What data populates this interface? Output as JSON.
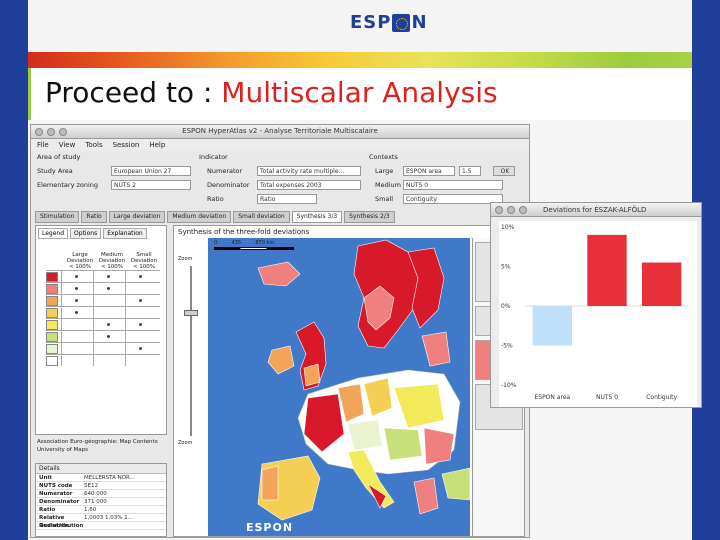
{
  "slide": {
    "logo_text": "ESP",
    "logo_text_end": "N",
    "title_plain": "Proceed to : ",
    "title_highlight": "Multiscalar Analysis"
  },
  "app": {
    "window_title": "ESPON HyperAtlas v2 - Analyse Territoriale Multiscalaire",
    "menu": [
      "File",
      "View",
      "Tools",
      "Session",
      "Help"
    ],
    "area_of_study_label": "Area of study",
    "study_area_label": "Study Area",
    "study_area_value": "European Union 27",
    "elementary_zoning_label": "Elementary zoning",
    "elementary_zoning_value": "NUTS 2",
    "indicator_label": "Indicator",
    "numerator_label": "Numerator",
    "numerator_value": "Total activity rate multiple...",
    "denominator_label": "Denominator",
    "denominator_value": "Total expenses 2003",
    "ratio_label": "Ratio",
    "ratio_value": "Ratio",
    "contexts_label": "Contexts",
    "large_label": "Large",
    "large_value": "ESPON area",
    "large_num": "1.5",
    "large_button": "OK",
    "medium_label": "Medium",
    "medium_value": "NUTS 0",
    "small_label": "Small",
    "small_value": "Contiguity",
    "tabs": [
      "Stimulation",
      "Ratio",
      "Large deviation",
      "Medium deviation",
      "Small deviation",
      "Synthesis 3/3",
      "Synthesis 2/3"
    ],
    "legend_tabs": [
      "Legend",
      "Options",
      "Explanation"
    ],
    "legend_headers": [
      "Large Deviation",
      "Medium Deviation",
      "Small Deviation"
    ],
    "legend_headers_sub": [
      "< 100%",
      "< 100%",
      "< 100%"
    ],
    "map_title": "Synthesis of the three-fold deviations",
    "scale_labels": [
      "0",
      "435",
      "870",
      "km"
    ],
    "zoom_label_top": "Zoom",
    "zoom_label_bottom": "Zoom",
    "map_credit": "Association Euro-géographie: Map Contents",
    "map_credit2": "University of Maps",
    "details_label": "Details",
    "details": [
      {
        "k": "Unit",
        "v": "MELLERSTA NOR..."
      },
      {
        "k": "NUTS code",
        "v": "SE12"
      },
      {
        "k": "Numerator",
        "v": "640 000"
      },
      {
        "k": "Denominator",
        "v": "371 000"
      },
      {
        "k": "Ratio",
        "v": "1,80"
      },
      {
        "k": "Relative Deviation",
        "v": "1,0003 1,03% 1..."
      },
      {
        "k": "Redistribution",
        "v": ""
      }
    ],
    "footer_logo": "ESPON"
  },
  "chart_window": {
    "title": "Deviations for ÉSZAK-ALFÖLD"
  },
  "chart_data": {
    "type": "bar",
    "title": "",
    "categories": [
      "ESPON area",
      "NUTS 0",
      "Contiguity"
    ],
    "values": [
      -5,
      9,
      5.5
    ],
    "ylim": [
      -10,
      10
    ],
    "yticks": [
      "10%",
      "5%",
      "0%",
      "-5%",
      "-10%"
    ],
    "colors": [
      "#bfe0f8",
      "#e8303a",
      "#e8303a"
    ]
  },
  "colors": {
    "espon_blue": "#1f3f9a",
    "title_red": "#e0201a",
    "legend_rows": [
      "#d7192a",
      "#f08080",
      "#f2a55a",
      "#f4cf53",
      "#f2ea5a",
      "#c8e07a",
      "#e9f3cf",
      "#ffffff"
    ]
  }
}
